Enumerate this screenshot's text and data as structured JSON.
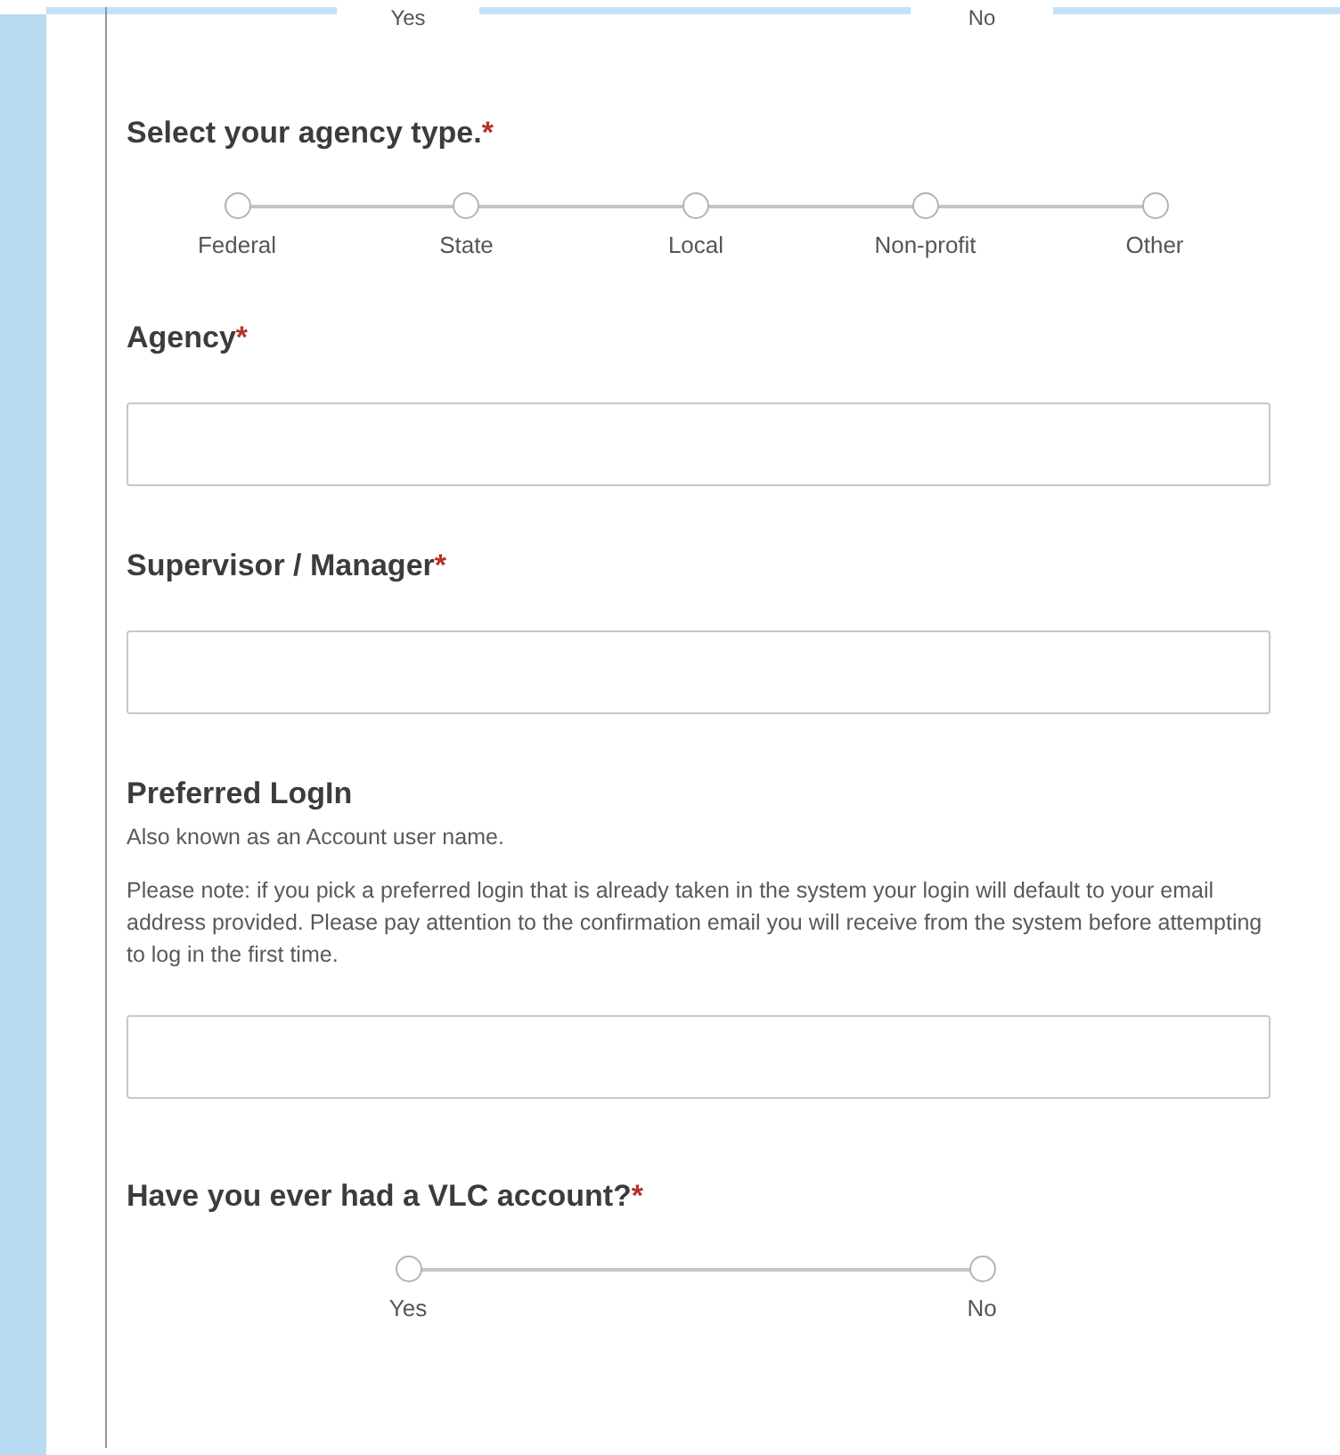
{
  "top_scale": {
    "labels": [
      "Yes",
      "No"
    ]
  },
  "fields": [
    {
      "kind": "scale",
      "label": "Select your agency type.",
      "required_mark": "*",
      "options": [
        {
          "label": "Federal",
          "selected": false
        },
        {
          "label": "State",
          "selected": false
        },
        {
          "label": "Local",
          "selected": false
        },
        {
          "label": "Non-profit",
          "selected": false
        },
        {
          "label": "Other",
          "selected": false
        }
      ]
    },
    {
      "kind": "text",
      "label": "Agency",
      "required_mark": "*"
    },
    {
      "kind": "text",
      "label": "Supervisor / Manager",
      "required_mark": "*"
    },
    {
      "kind": "text",
      "label": "Preferred LogIn",
      "notes": [
        "Also known as an Account user name.",
        "Please note: if you pick a preferred login that is already taken in the system your login will default to your email address provided. Please pay attention to the confirmation email you will receive from the system before attempting to log in the first time."
      ]
    },
    {
      "kind": "scale",
      "label": "Have you ever had a VLC account?",
      "required_mark": "*",
      "options": [
        {
          "label": "Yes",
          "selected": false
        },
        {
          "label": "No",
          "selected": false
        }
      ]
    }
  ]
}
